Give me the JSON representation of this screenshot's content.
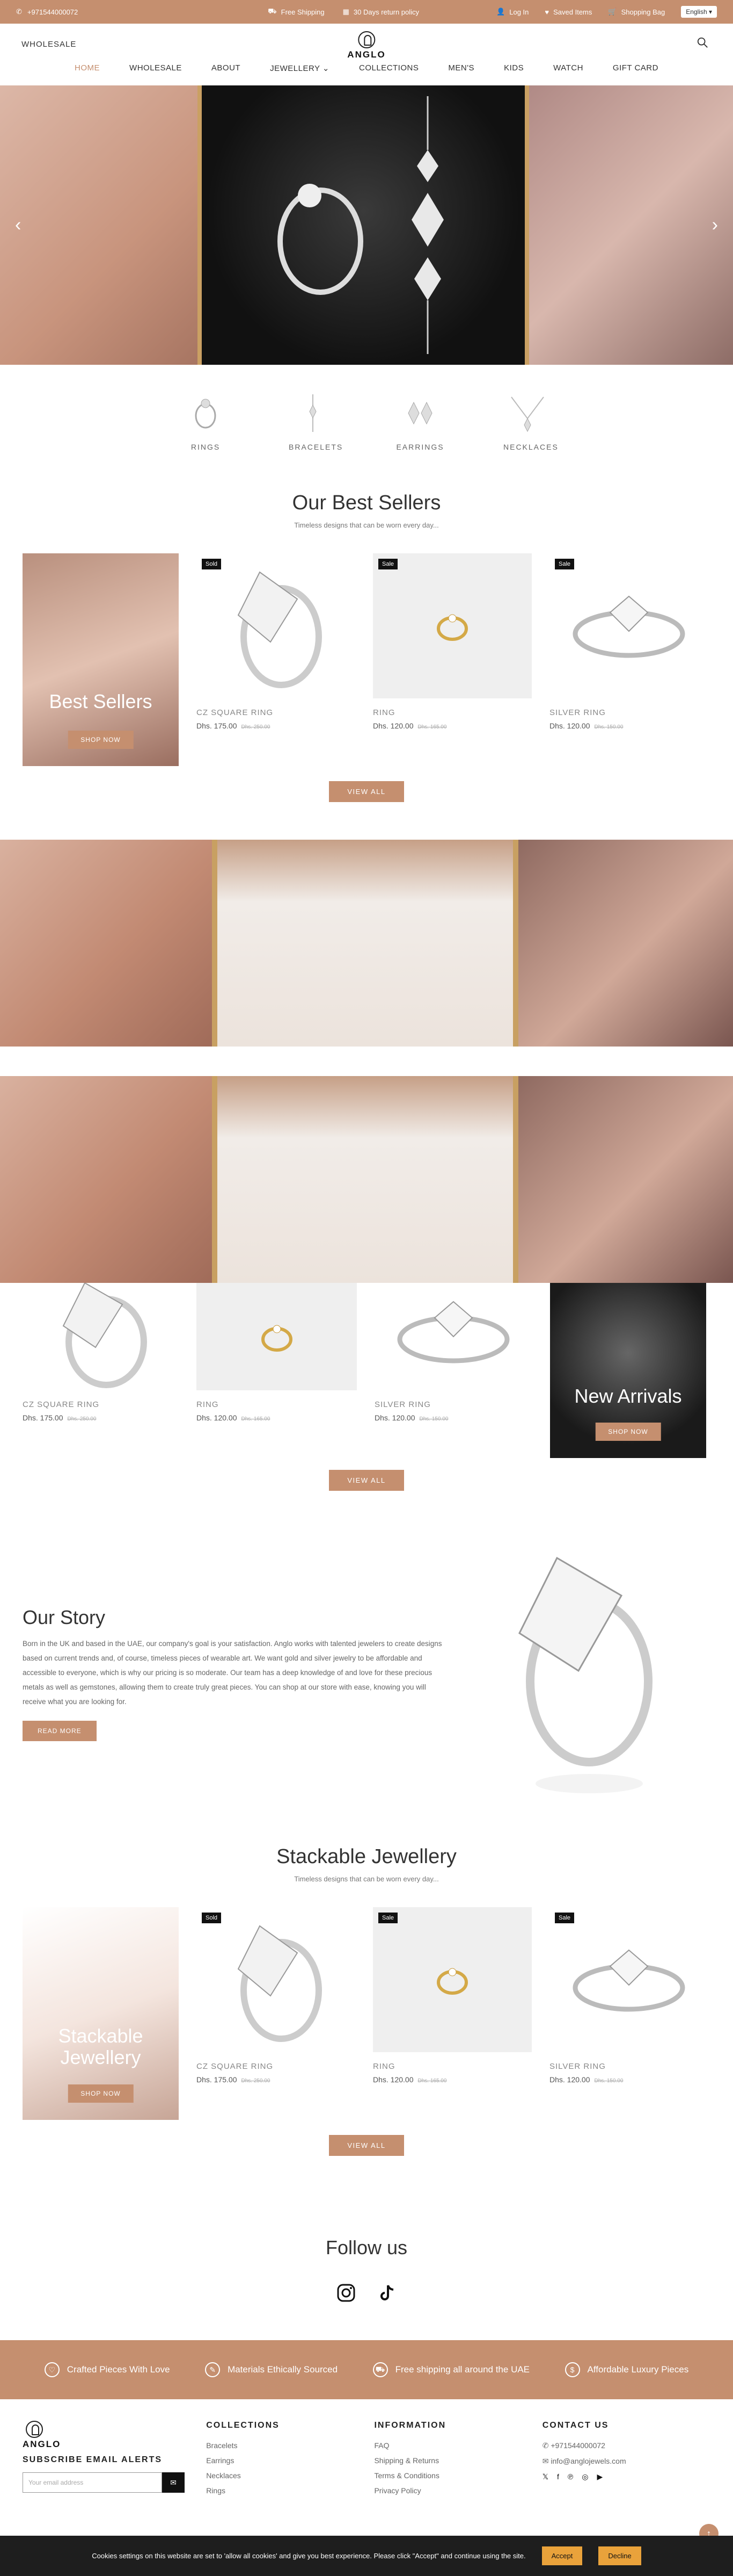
{
  "topbar": {
    "phone": "+971544000072",
    "shipping": "Free Shipping",
    "returns": "30 Days return policy",
    "login": "Log In",
    "saved": "Saved Items",
    "bag": "Shopping Bag",
    "language": "English"
  },
  "header": {
    "wholesale": "WHOLESALE",
    "logo": "ANGLO"
  },
  "nav": [
    "HOME",
    "WHOLESALE",
    "ABOUT",
    "JEWELLERY",
    "COLLECTIONS",
    "MEN'S",
    "KIDS",
    "WATCH",
    "GIFT CARD"
  ],
  "categories": [
    "RINGS",
    "BRACELETS",
    "EARRINGS",
    "NECKLACES"
  ],
  "bestsellers": {
    "title": "Our Best Sellers",
    "subtitle": "Timeless designs that can be worn every day...",
    "promo_title": "Best Sellers",
    "promo_btn": "SHOP NOW"
  },
  "products": [
    {
      "badge": "Sold",
      "name": "CZ SQUARE RING",
      "price": "Dhs. 175.00",
      "old": "Dhs. 250.00"
    },
    {
      "badge": "Sale",
      "name": "RING",
      "price": "Dhs. 120.00",
      "old": "Dhs. 165.00"
    },
    {
      "badge": "Sale",
      "name": "SILVER RING",
      "price": "Dhs. 120.00",
      "old": "Dhs. 150.00"
    }
  ],
  "view_all": "VIEW ALL",
  "arrivals": {
    "title": "New Arrivals",
    "btn": "SHOP NOW"
  },
  "story": {
    "title": "Our Story",
    "text": "Born in the UK and based in the UAE, our company's goal is your satisfaction. Anglo works with talented jewelers to create designs based on current trends and, of course, timeless pieces of wearable art. We want gold and silver jewelry to be affordable and accessible to everyone, which is why our pricing is so moderate. Our team has a deep knowledge of and love for these precious metals as well as gemstones, allowing them to create truly great pieces. You can shop at our store with ease, knowing you will receive what you are looking for.",
    "btn": "READ MORE"
  },
  "stackable": {
    "title": "Stackable Jewellery",
    "subtitle": "Timeless designs that can be worn every day...",
    "promo_title": "Stackable Jewellery",
    "promo_btn": "SHOP NOW"
  },
  "follow": {
    "title": "Follow us"
  },
  "features": [
    "Crafted Pieces With Love",
    "Materials Ethically Sourced",
    "Free shipping all around the UAE",
    "Affordable Luxury Pieces"
  ],
  "footer": {
    "subscribe": "SUBSCRIBE EMAIL ALERTS",
    "email_placeholder": "Your email address",
    "collections_title": "COLLECTIONS",
    "collections": [
      "Bracelets",
      "Earrings",
      "Necklaces",
      "Rings"
    ],
    "info_title": "INFORMATION",
    "info": [
      "FAQ",
      "Shipping & Returns",
      "Terms & Conditions",
      "Privacy Policy"
    ],
    "contact_title": "CONTACT US",
    "phone": "+971544000072",
    "email": "info@anglojewels.com"
  },
  "cookie": {
    "text": "Cookies settings on this website are set to 'allow all cookies' and give you best experience. Please click \"Accept\" and continue using the site.",
    "accept": "Accept",
    "decline": "Decline"
  },
  "colors": {
    "accent": "#c58f6f",
    "dark": "#111111"
  }
}
